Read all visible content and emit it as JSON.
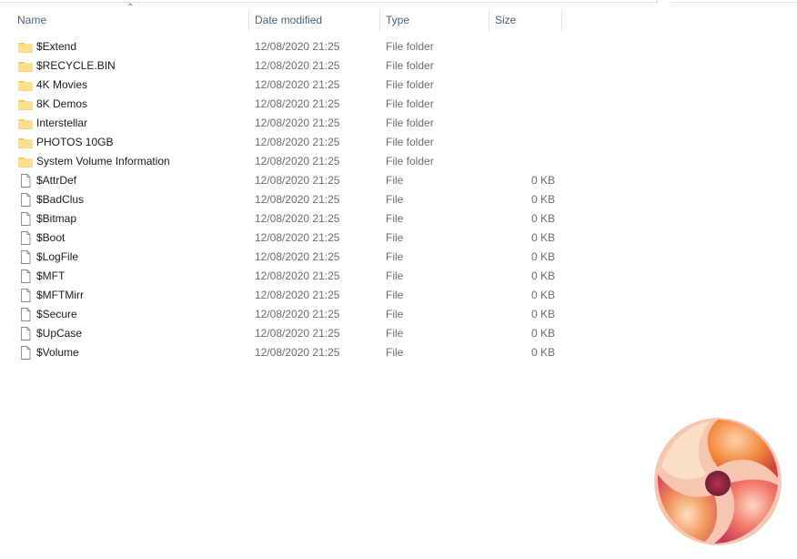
{
  "columns": {
    "name": "Name",
    "date": "Date modified",
    "type": "Type",
    "size": "Size"
  },
  "sort": {
    "column": "Name",
    "icon": "sort-ascending-chevron"
  },
  "items": [
    {
      "name": "$Extend",
      "date": "12/08/2020 21:25",
      "type": "File folder",
      "size": "",
      "icon": "folder-icon"
    },
    {
      "name": "$RECYCLE.BIN",
      "date": "12/08/2020 21:25",
      "type": "File folder",
      "size": "",
      "icon": "folder-icon"
    },
    {
      "name": "4K Movies",
      "date": "12/08/2020 21:25",
      "type": "File folder",
      "size": "",
      "icon": "folder-icon"
    },
    {
      "name": "8K Demos",
      "date": "12/08/2020 21:25",
      "type": "File folder",
      "size": "",
      "icon": "folder-icon"
    },
    {
      "name": "Interstellar",
      "date": "12/08/2020 21:25",
      "type": "File folder",
      "size": "",
      "icon": "folder-icon"
    },
    {
      "name": "PHOTOS 10GB",
      "date": "12/08/2020 21:25",
      "type": "File folder",
      "size": "",
      "icon": "folder-icon"
    },
    {
      "name": "System Volume Information",
      "date": "12/08/2020 21:25",
      "type": "File folder",
      "size": "",
      "icon": "folder-icon"
    },
    {
      "name": "$AttrDef",
      "date": "12/08/2020 21:25",
      "type": "File",
      "size": "0 KB",
      "icon": "file-icon"
    },
    {
      "name": "$BadClus",
      "date": "12/08/2020 21:25",
      "type": "File",
      "size": "0 KB",
      "icon": "file-icon"
    },
    {
      "name": "$Bitmap",
      "date": "12/08/2020 21:25",
      "type": "File",
      "size": "0 KB",
      "icon": "file-icon"
    },
    {
      "name": "$Boot",
      "date": "12/08/2020 21:25",
      "type": "File",
      "size": "0 KB",
      "icon": "file-icon"
    },
    {
      "name": "$LogFile",
      "date": "12/08/2020 21:25",
      "type": "File",
      "size": "0 KB",
      "icon": "file-icon"
    },
    {
      "name": "$MFT",
      "date": "12/08/2020 21:25",
      "type": "File",
      "size": "0 KB",
      "icon": "file-icon"
    },
    {
      "name": "$MFTMirr",
      "date": "12/08/2020 21:25",
      "type": "File",
      "size": "0 KB",
      "icon": "file-icon"
    },
    {
      "name": "$Secure",
      "date": "12/08/2020 21:25",
      "type": "File",
      "size": "0 KB",
      "icon": "file-icon"
    },
    {
      "name": "$UpCase",
      "date": "12/08/2020 21:25",
      "type": "File",
      "size": "0 KB",
      "icon": "file-icon"
    },
    {
      "name": "$Volume",
      "date": "12/08/2020 21:25",
      "type": "File",
      "size": "0 KB",
      "icon": "file-icon"
    }
  ],
  "colors": {
    "header_text": "#4c607a",
    "secondary_text": "#6d6d6d",
    "folder_yellow": "#ffd75e",
    "logo_orange": "#f28a3f",
    "logo_pink": "#f05a8c"
  },
  "watermark": {
    "icon": "brand-logo-icon"
  }
}
